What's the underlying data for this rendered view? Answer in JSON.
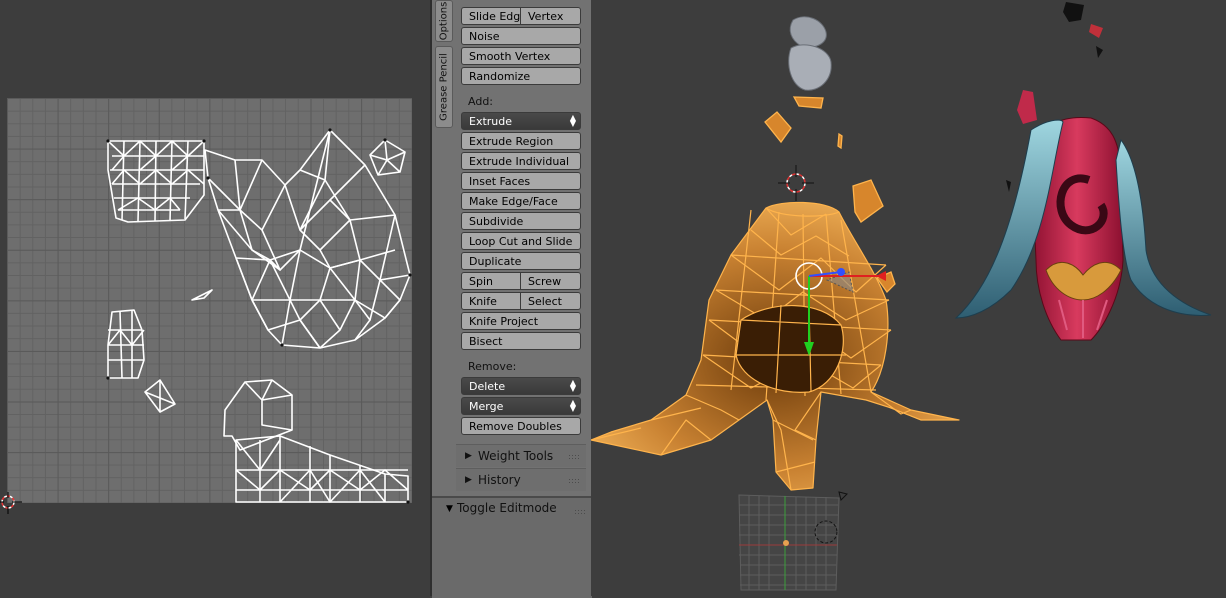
{
  "shelf": {
    "tabs": [
      "Options",
      "Grease Pencil"
    ],
    "deform": {
      "slide_edge": "Slide Edge",
      "vertex": "Vertex",
      "noise": "Noise",
      "smooth_vertex": "Smooth Vertex",
      "randomize": "Randomize"
    },
    "add": {
      "label": "Add:",
      "extrude": "Extrude",
      "extrude_region": "Extrude Region",
      "extrude_individual": "Extrude Individual",
      "inset_faces": "Inset Faces",
      "make_edge_face": "Make Edge/Face",
      "subdivide": "Subdivide",
      "loop_cut": "Loop Cut and Slide",
      "duplicate": "Duplicate",
      "spin": "Spin",
      "screw": "Screw",
      "knife": "Knife",
      "select": "Select",
      "knife_project": "Knife Project",
      "bisect": "Bisect"
    },
    "remove": {
      "label": "Remove:",
      "delete": "Delete",
      "merge": "Merge",
      "remove_doubles": "Remove Doubles"
    },
    "panels": {
      "weight_tools": "Weight Tools",
      "history": "History",
      "toggle_editmode": "Toggle Editmode"
    }
  },
  "colors": {
    "background": "#3d3d3d",
    "uv_grid": "#6e6e6e",
    "shelf": "#727272",
    "button": "#a8a8a8",
    "mesh_select": "#f5a030",
    "uv_wire": "#ffffff"
  },
  "icons": [
    "3d-cursor-icon",
    "uv-cursor-icon",
    "disclosure-triangle-icon",
    "panel-grip-icon",
    "dropdown-arrows-icon"
  ]
}
